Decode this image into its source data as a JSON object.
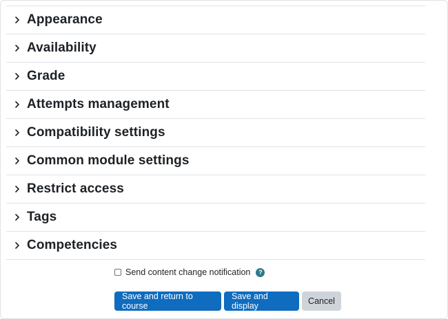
{
  "sections": [
    {
      "label": "Appearance"
    },
    {
      "label": "Availability"
    },
    {
      "label": "Grade"
    },
    {
      "label": "Attempts management"
    },
    {
      "label": "Compatibility settings"
    },
    {
      "label": "Common module settings"
    },
    {
      "label": "Restrict access"
    },
    {
      "label": "Tags"
    },
    {
      "label": "Competencies"
    }
  ],
  "notification": {
    "label": "Send content change notification",
    "checked": false,
    "help_icon": "question-circle-icon",
    "help_glyph": "?"
  },
  "buttons": {
    "save_return": "Save and return to course",
    "save_display": "Save and display",
    "cancel": "Cancel"
  },
  "colors": {
    "primary": "#0f6cbf",
    "secondary": "#ced4da",
    "help": "#2c7a8c"
  }
}
